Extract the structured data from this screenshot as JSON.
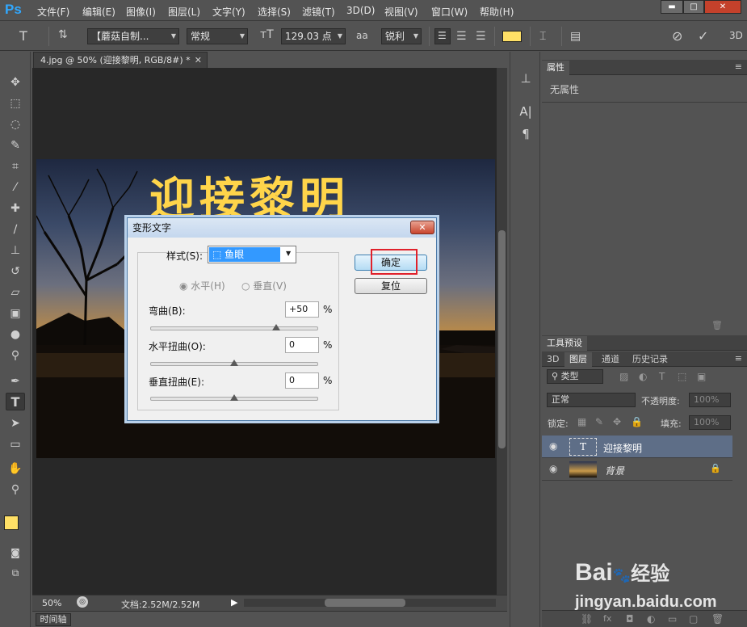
{
  "app": {
    "logo": "Ps"
  },
  "menu": [
    "文件(F)",
    "编辑(E)",
    "图像(I)",
    "图层(L)",
    "文字(Y)",
    "选择(S)",
    "滤镜(T)",
    "3D(D)",
    "视图(V)",
    "窗口(W)",
    "帮助(H)"
  ],
  "window_buttons": [
    "▬",
    "□",
    "✕"
  ],
  "options": {
    "font_family": "【蘑菇自制...",
    "font_style": "常规",
    "font_size": "129.03 点",
    "antialias_icon": "aa",
    "antialias": "锐利",
    "color_swatch": "#ffe066",
    "right_label": "3D"
  },
  "document": {
    "tab_title": "4.jpg @ 50% (迎接黎明, RGB/8#) *",
    "close": "✕",
    "warped_text": "迎接黎明",
    "text_color": "#ffd54a"
  },
  "status": {
    "zoom": "50%",
    "doc_info": "文档:2.52M/2.52M",
    "timeline": "时间轴"
  },
  "properties": {
    "tab": "属性",
    "empty_text": "无属性"
  },
  "tool_presets": {
    "tab": "工具预设"
  },
  "layers_panel": {
    "tabs": [
      "3D",
      "图层",
      "通道",
      "历史记录"
    ],
    "active_tab": "图层",
    "kind_filter": "类型",
    "blend_mode": "正常",
    "opacity_label": "不透明度:",
    "opacity": "100%",
    "lock_label": "锁定:",
    "fill_label": "填充:",
    "fill": "100%",
    "layers": [
      {
        "name": "迎接黎明",
        "thumb": "T",
        "selected": true
      },
      {
        "name": "背景",
        "thumb": "",
        "selected": false,
        "locked": true
      }
    ]
  },
  "dialog": {
    "title": "变形文字",
    "close": "✕",
    "style_label": "样式(S):",
    "style_value": "鱼眼",
    "horizontal": "水平(H)",
    "vertical": "垂直(V)",
    "bend_label": "弯曲(B):",
    "bend_value": "+50",
    "hdist_label": "水平扭曲(O):",
    "hdist_value": "0",
    "vdist_label": "垂直扭曲(E):",
    "vdist_value": "0",
    "percent": "%",
    "ok": "确定",
    "reset": "复位",
    "bend_level_pct": 75,
    "hdist_level_pct": 50,
    "vdist_level_pct": 50
  },
  "watermark": {
    "brand": "Bai",
    "brand_tail": "经验",
    "url": "jingyan.baidu.com"
  }
}
